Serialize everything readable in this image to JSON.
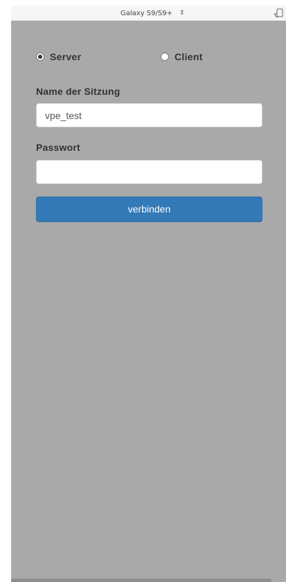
{
  "devtools": {
    "device_name": "Galaxy S9/S9+",
    "device_arrows": "⇕",
    "rotate_icon": "rotate-device-icon"
  },
  "form": {
    "mode_options": [
      {
        "label": "Server",
        "selected": true
      },
      {
        "label": "Client",
        "selected": false
      }
    ],
    "session_label": "Name der Sitzung",
    "session_value": "vpe_test",
    "password_label": "Passwort",
    "password_value": "",
    "connect_label": "verbinden"
  },
  "colors": {
    "viewport_bg": "#a9a9a9",
    "button_bg": "#337ab7",
    "text": "#333333"
  }
}
